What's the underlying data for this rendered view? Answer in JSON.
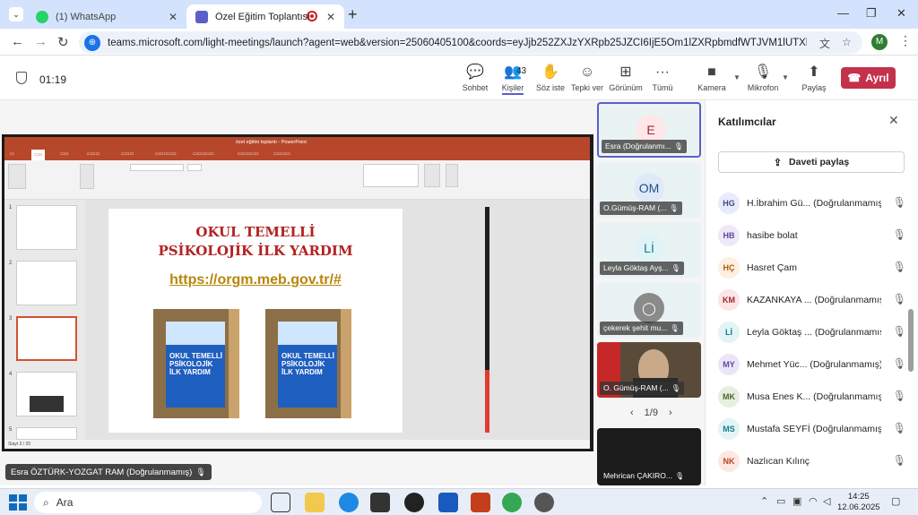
{
  "browser": {
    "tabs": [
      {
        "title": "(1) WhatsApp",
        "icon": "whatsapp-icon"
      },
      {
        "title": "Özel Eğitim Toplantısı | Mic",
        "icon": "teams-icon"
      }
    ],
    "url": "teams.microsoft.com/light-meetings/launch?agent=web&version=25060405100&coords=eyJjb252ZXJzYXRpb25JZCI6IjE5Om1lZXRpbmdfWTJVM1lUTXlZMlV0TTJJNE1T...",
    "profile_initial": "M"
  },
  "meeting": {
    "timer": "01:19",
    "participant_count": "43",
    "tools": {
      "chat": "Sohbet",
      "people": "Kişiler",
      "raise": "Söz iste",
      "react": "Tepki ver",
      "view": "Görünüm",
      "more": "Tümü",
      "camera": "Kamera",
      "mic": "Mikrofon",
      "share": "Paylaş"
    },
    "leave": "Ayrıl"
  },
  "presentation": {
    "window_title": "özel eğitim toplantı - PowerPoint",
    "slide_title_1": "OKUL TEMELLİ",
    "slide_title_2": "PSİKOLOJİK İLK YARDIM",
    "slide_link": "https://orgm.meb.gov.tr/#",
    "book_text": "OKUL TEMELLİ PSİKOLOJİK İLK YARDIM",
    "status_left": "Slayt 3 / 20",
    "presenter": "Esra ÖZTÜRK-YOZGAT RAM (Doğrulanmamış)"
  },
  "tiles": [
    {
      "initial": "E",
      "name": "Esra (Doğrulanmı...",
      "color": "#fde7e9",
      "textcolor": "#a4262c"
    },
    {
      "initial": "OM",
      "name": "O.Gümüş-RAM (...",
      "color": "#e0eaf7",
      "textcolor": "#1d4f91"
    },
    {
      "initial": "Lİ",
      "name": "Leyla Göktaş Ayş...",
      "color": "#e0f4f7",
      "textcolor": "#137d8a"
    },
    {
      "initial": "",
      "name": "çekerek şehit mu...",
      "color": "#c8c8c8",
      "textcolor": "#fff"
    },
    {
      "initial": "",
      "name": "O. Gümüş-RAM (...",
      "color": "#444",
      "textcolor": "#fff"
    },
    {
      "initial": "",
      "name": "Mehrican ÇAKIRO...",
      "color": "#1b1b1b",
      "textcolor": "#fff"
    }
  ],
  "pager": "1/9",
  "panel": {
    "title": "Katılımcılar",
    "invite": "Daveti paylaş",
    "participants": [
      {
        "initials": "HG",
        "name": "H.İbrahim Gü... (Doğrulanmamış)",
        "bg": "#e8ebfa",
        "fg": "#3d4a8a"
      },
      {
        "initials": "HB",
        "name": "hasibe bolat",
        "bg": "#ede9f7",
        "fg": "#5c4a9e"
      },
      {
        "initials": "HÇ",
        "name": "Hasret Çam",
        "bg": "#fdf0e1",
        "fg": "#b05e0b"
      },
      {
        "initials": "KM",
        "name": "KAZANKAYA ... (Doğrulanmamış)",
        "bg": "#fbe5e6",
        "fg": "#a4262c"
      },
      {
        "initials": "Lİ",
        "name": "Leyla Göktaş ... (Doğrulanmamış)",
        "bg": "#e3f4f7",
        "fg": "#137d8a"
      },
      {
        "initials": "MY",
        "name": "Mehmet Yüc... (Doğrulanmamış)",
        "bg": "#eae6f7",
        "fg": "#5c4a9e"
      },
      {
        "initials": "MK",
        "name": "Musa Enes K... (Doğrulanmamış)",
        "bg": "#e6efe0",
        "fg": "#4a6b2a"
      },
      {
        "initials": "MS",
        "name": "Mustafa SEYFİ (Doğrulanmamış)",
        "bg": "#e3f4f7",
        "fg": "#137d8a"
      },
      {
        "initials": "NK",
        "name": "Nazlıcan Kılınç",
        "bg": "#fde7e0",
        "fg": "#b5462b"
      }
    ]
  },
  "taskbar": {
    "search": "Ara",
    "time": "14:25",
    "date": "12.06.2025"
  }
}
